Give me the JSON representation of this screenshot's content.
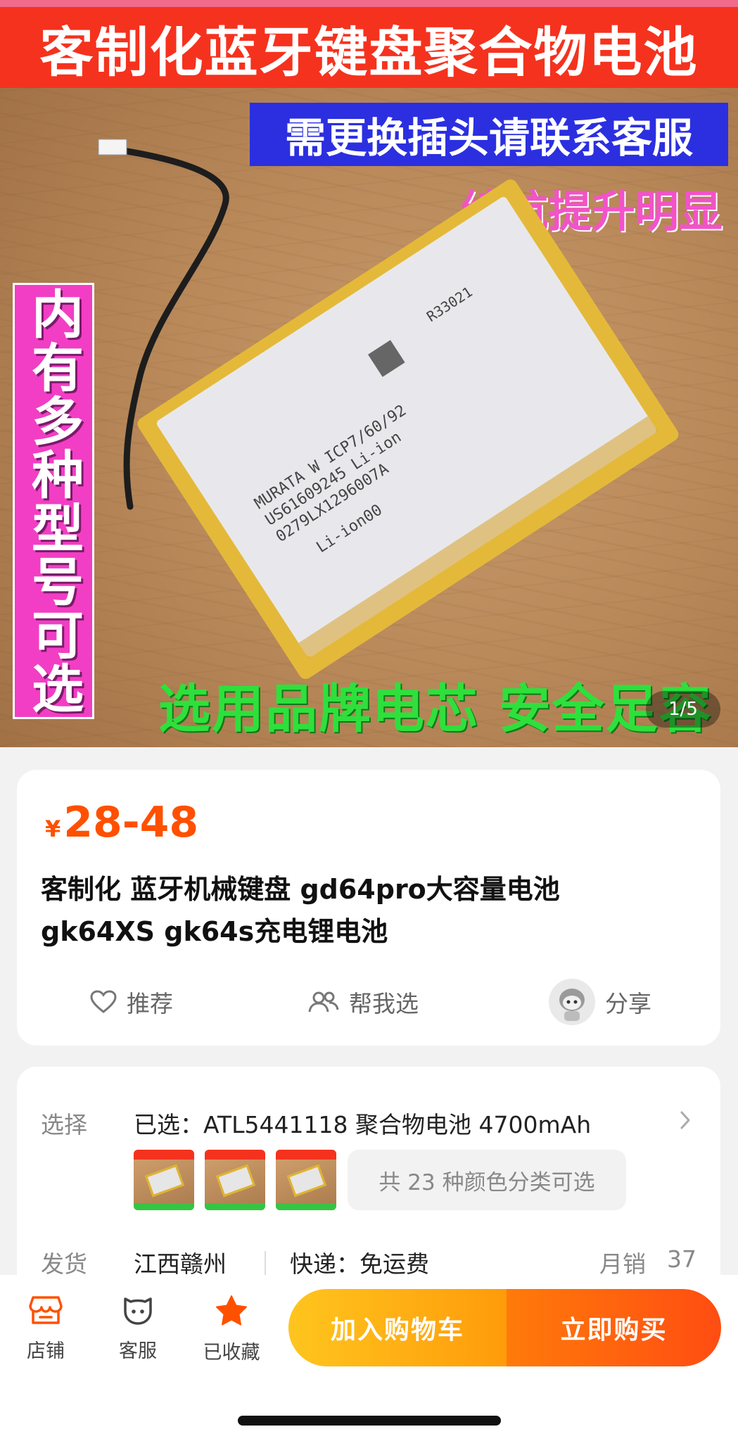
{
  "hero": {
    "title_banner": "客制化蓝牙键盘聚合物电池",
    "blue_banner": "需更换插头请联系客服",
    "pink_text": "续航提升明显",
    "side_banner": "内有多种型号可选",
    "green_text": "选用品牌电芯 安全足容",
    "battery_label_lines": [
      "MURATA W ICP7/60/92",
      "US61609245 Li-ion",
      "0279LX1296007A",
      "Li-ion00"
    ],
    "battery_mark": "R33021",
    "page_indicator": "1/5"
  },
  "product": {
    "currency": "¥",
    "price_range": "28-48",
    "price_color": "#ff5000",
    "title": "客制化 蓝牙机械键盘 gd64pro大容量电池 gk64XS gk64s充电锂电池",
    "actions": {
      "recommend": "推荐",
      "help_choose": "帮我选",
      "share": "分享"
    }
  },
  "selection": {
    "label": "选择",
    "selected": "已选：ATL5441118 聚合物电池 4700mAh",
    "variants_chip": "共 23 种颜色分类可选"
  },
  "shipping": {
    "label": "发货",
    "origin": "江西赣州",
    "express": "快递：免运费",
    "sales_label": "月销",
    "sales_value": "37"
  },
  "bottom_bar": {
    "store": "店铺",
    "service": "客服",
    "favorited": "已收藏",
    "add_to_cart": "加入购物车",
    "buy_now": "立即购买",
    "accent_color": "#ff5000"
  }
}
